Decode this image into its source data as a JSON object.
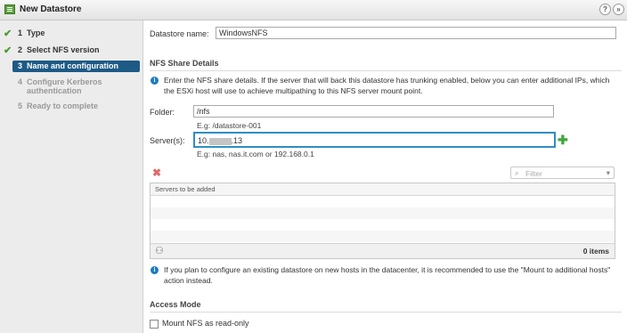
{
  "window": {
    "title": "New Datastore",
    "help_label": "?",
    "nav_label": "»"
  },
  "steps": [
    {
      "num": "1",
      "label": "Type",
      "state": "done"
    },
    {
      "num": "2",
      "label": "Select NFS version",
      "state": "done"
    },
    {
      "num": "3",
      "label": "Name and configuration",
      "state": "active"
    },
    {
      "num": "4",
      "label": "Configure Kerberos authentication",
      "state": "disabled"
    },
    {
      "num": "5",
      "label": "Ready to complete",
      "state": "disabled"
    }
  ],
  "form": {
    "datastore_name_label": "Datastore name:",
    "datastore_name_value": "WindowsNFS",
    "nfs_section_title": "NFS Share Details",
    "nfs_info": "Enter the NFS share details. If the server that will back this datastore has trunking enabled, below you can enter additional IPs, which the ESXi host will use to achieve multipathing to this NFS server mount point.",
    "folder_label": "Folder:",
    "folder_value": "/nfs",
    "folder_hint": "E.g: /datastore-001",
    "servers_label": "Server(s):",
    "server_value_prefix": "10.",
    "server_value_suffix": ".13",
    "servers_hint": "E.g: nas, nas.it.com or 192.168.0.1",
    "filter_placeholder": "Filter",
    "table_header": "Servers to be added",
    "table_count": "0 items",
    "mount_info": "If you plan to configure an existing datastore on new hosts in the datacenter, it is recommended to use the \"Mount to additional hosts\" action instead.",
    "access_mode_title": "Access Mode",
    "readonly_label": "Mount NFS as read-only"
  },
  "icons": {
    "check": "✔",
    "info": "i",
    "add": "✚",
    "remove": "✖",
    "binoculars": "⚇",
    "search": "⌕",
    "dropdown": "▾"
  },
  "colors": {
    "active_step": "#1d5a86",
    "accent_focus": "#2f8ec2",
    "add_green": "#3fa83a",
    "remove_red": "#e06a6a",
    "info_blue": "#1c7bc0"
  }
}
